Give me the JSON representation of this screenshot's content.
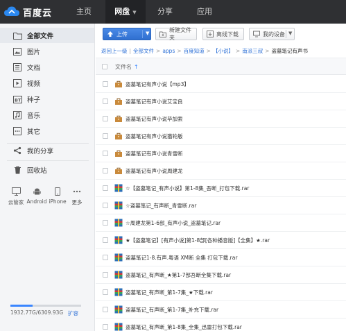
{
  "app": {
    "logo_text": "百度云",
    "nav": [
      {
        "label": "主页"
      },
      {
        "label": "网盘"
      },
      {
        "label": "分享"
      },
      {
        "label": "应用"
      }
    ]
  },
  "sidebar": {
    "items": [
      {
        "label": "全部文件",
        "icon": "folder-icon"
      },
      {
        "label": "图片",
        "icon": "image-icon"
      },
      {
        "label": "文档",
        "icon": "document-icon"
      },
      {
        "label": "视频",
        "icon": "video-icon"
      },
      {
        "label": "种子",
        "icon": "torrent-icon"
      },
      {
        "label": "音乐",
        "icon": "music-icon"
      },
      {
        "label": "其它",
        "icon": "other-icon"
      },
      {
        "label": "我的分享",
        "icon": "share-icon"
      },
      {
        "label": "回收站",
        "icon": "trash-icon"
      }
    ],
    "devices": [
      {
        "label": "云管家",
        "icon": "monitor-icon"
      },
      {
        "label": "Android",
        "icon": "android-icon"
      },
      {
        "label": "iPhone",
        "icon": "iphone-icon"
      },
      {
        "label": "更多",
        "icon": "more-icon"
      }
    ],
    "quota": {
      "text": "1932.77G/6309.93G",
      "used_fraction": 0.31,
      "expand_label": "扩容"
    }
  },
  "toolbar": {
    "upload_label": "上传",
    "new_folder_label": "新建文件夹",
    "offline_label": "离线下载",
    "devices_label": "我的设备"
  },
  "breadcrumb": {
    "back": "返回上一级",
    "items": [
      "全部文件",
      "apps",
      "百度知道",
      "【小说】",
      "南派三叔"
    ],
    "current": "盗墓笔记有声书"
  },
  "list": {
    "header_name": "文件名",
    "sort_arrow": "↑",
    "files": [
      {
        "name": "盗墓笔记有声小说【mp3】",
        "type": "folder"
      },
      {
        "name": "盗墓笔记有声小说艾宝良",
        "type": "folder"
      },
      {
        "name": "盗墓笔记有声小说毕加索",
        "type": "folder"
      },
      {
        "name": "盗墓笔记有声小说猫轮舨",
        "type": "folder"
      },
      {
        "name": "盗墓笔记有声小说青雪断",
        "type": "folder"
      },
      {
        "name": "盗墓笔记有声小说周建龙",
        "type": "folder"
      },
      {
        "name": "☆【盗墓笔记_有声小说】第1-8集_吾断_打包下载.rar",
        "type": "archive"
      },
      {
        "name": "☆盗墓笔记_有声断_青雪断.rar",
        "type": "archive"
      },
      {
        "name": "☆周建龙第1-6部_有声小说_盗墓笔记.rar",
        "type": "archive"
      },
      {
        "name": "★【盗墓笔记】[有声小说]第1-8部[各种播音版]【全集】★.rar",
        "type": "archive"
      },
      {
        "name": "盗墓笔记1-8.有声.粤语 XM断 全集 打包下载.rar",
        "type": "archive"
      },
      {
        "name": "盗墓笔记_有声断_★第1-7部吾断全集下载.rar",
        "type": "archive"
      },
      {
        "name": "盗墓笔记_有声断_第1-7集_★下载.rar",
        "type": "archive"
      },
      {
        "name": "盗墓笔记_有声断_第1-7集_补充下载.rar",
        "type": "archive"
      },
      {
        "name": "盗墓笔记_有声断_第1-8集_全集_迅雷打包下载.rar",
        "type": "archive"
      }
    ]
  }
}
